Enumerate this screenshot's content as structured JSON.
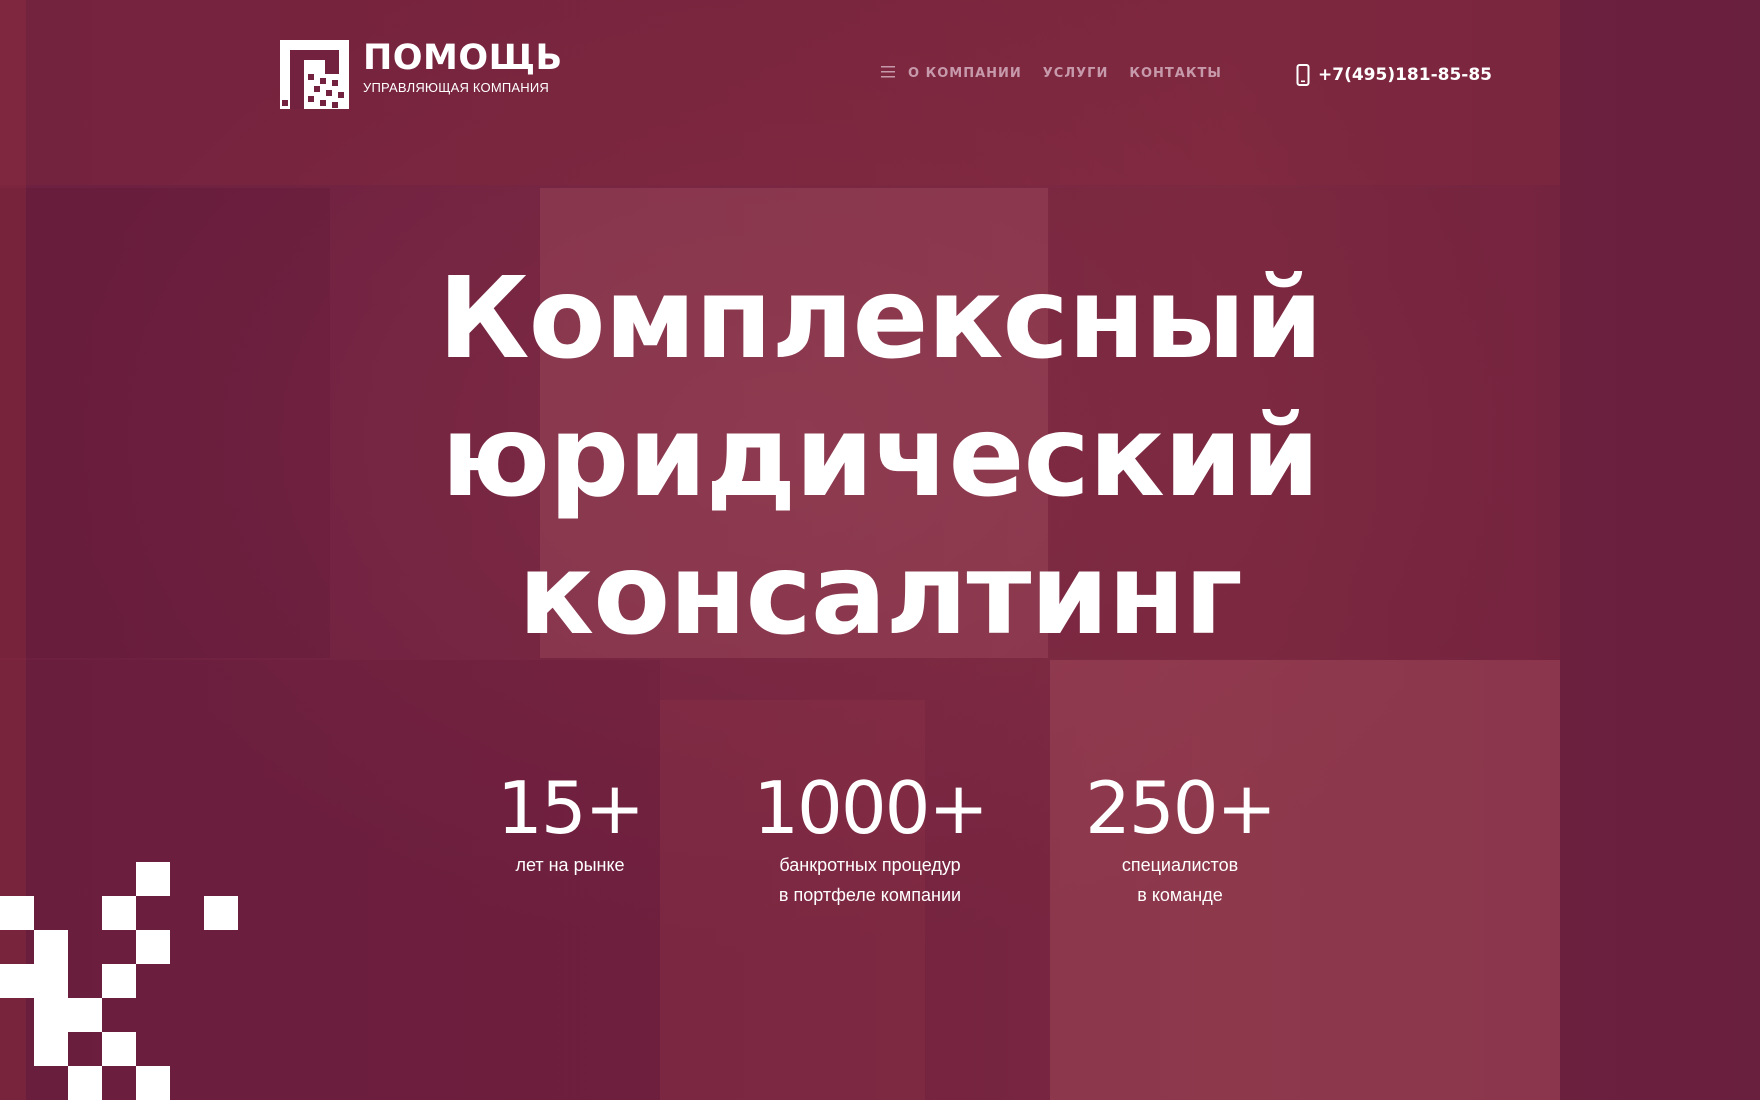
{
  "logo": {
    "title": "ПОМОЩЬ",
    "subtitle": "УПРАВЛЯЮЩАЯ КОМПАНИЯ",
    "icon": "qr-logo-icon"
  },
  "nav": {
    "menu_icon": "hamburger-icon",
    "items": [
      {
        "label": "О КОМПАНИИ"
      },
      {
        "label": "УСЛУГИ"
      },
      {
        "label": "КОНТАКТЫ"
      }
    ]
  },
  "contact": {
    "phone_icon": "mobile-phone-icon",
    "phone": "+7(495)181-85-85"
  },
  "hero": {
    "headline_lines": [
      "Комплексный",
      "юридический",
      "консалтинг"
    ]
  },
  "stats": [
    {
      "value": "15+",
      "label_lines": [
        "лет на рынке"
      ]
    },
    {
      "value": "1000+",
      "label_lines": [
        "банкротных процедур",
        "в портфеле компании"
      ]
    },
    {
      "value": "250+",
      "label_lines": [
        "специалистов",
        "в команде"
      ]
    }
  ],
  "colors": {
    "background": "#6e2141",
    "text": "#ffffff",
    "nav_text": "#c79aab"
  }
}
